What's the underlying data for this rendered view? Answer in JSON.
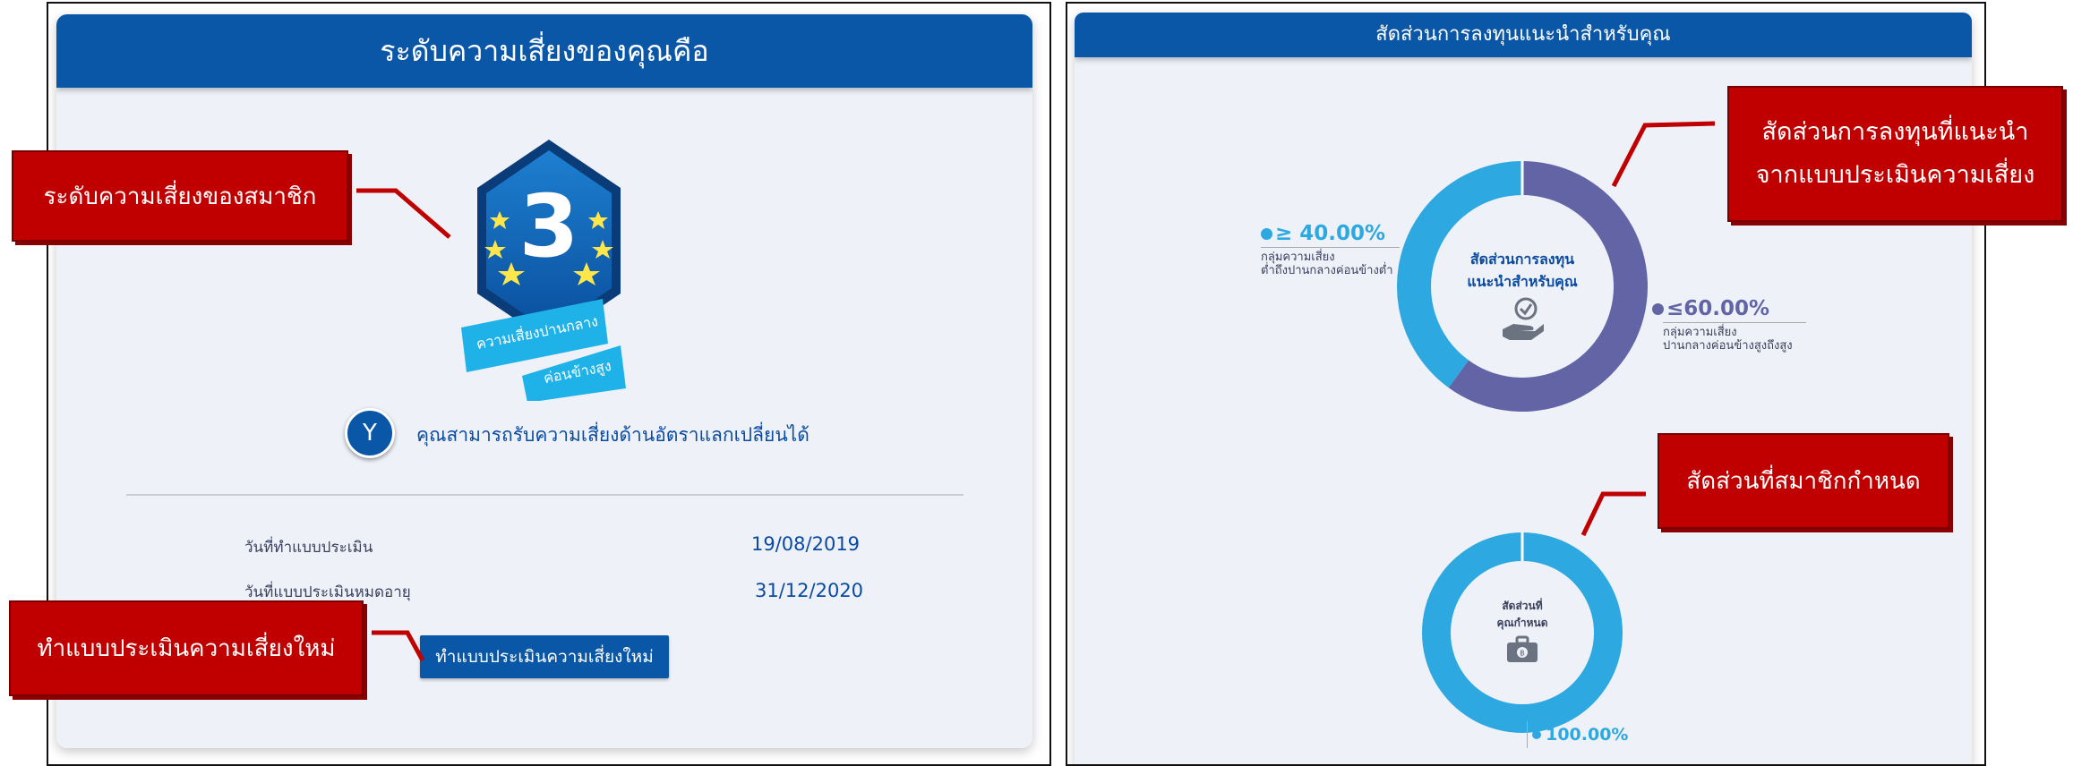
{
  "left_panel": {
    "title": "ระดับความเสี่ยงของคุณคือ",
    "badge": {
      "level": "3",
      "ribbon_line1": "ความเสี่ยงปานกลาง",
      "ribbon_line2": "ค่อนข้างสูง"
    },
    "fx_icon_letter": "Y",
    "fx_text": "คุณสามารถรับความเสี่ยงด้านอัตราแลกเปลี่ยนได้",
    "info_rows": [
      {
        "label": "วันที่ทำแบบประเมิน",
        "value": "19/08/2019"
      },
      {
        "label": "วันที่แบบประเมินหมดอายุ",
        "value": "31/12/2020"
      }
    ],
    "reassess_button": "ทำแบบประเมินความเสี่ยงใหม่"
  },
  "right_panel": {
    "title": "สัดส่วนการลงทุนแนะนำสำหรับคุณ",
    "recommended_donut": {
      "center_line1": "สัดส่วนการลงทุน",
      "center_line2": "แนะนำสำหรับคุณ",
      "segments": [
        {
          "value_label": "≥ 40.00%",
          "desc_line1": "กลุ่มความเสี่ยง",
          "desc_line2": "ต่ำถึงปานกลางค่อนข้างต่ำ",
          "percent": 40,
          "color": "#2ea8e0"
        },
        {
          "value_label": "≤60.00%",
          "desc_line1": "กลุ่มความเสี่ยง",
          "desc_line2": "ปานกลางค่อนข้างสูงถึงสูง",
          "percent": 60,
          "color": "#6364a6"
        }
      ]
    },
    "member_donut": {
      "center_line1": "สัดส่วนที่",
      "center_line2": "คุณกำหนด",
      "value_label": "100.00%",
      "percent": 100,
      "color": "#2ea8e0"
    }
  },
  "callouts": {
    "member_risk_level": "ระดับความเสี่ยงของสมาชิก",
    "new_assessment": "ทำแบบประเมินความเสี่ยงใหม่",
    "recommended_ratio_line1": "สัดส่วนการลงทุนที่แนะนำ",
    "recommended_ratio_line2": "จากแบบประเมินความเสี่ยง",
    "member_defined_ratio": "สัดส่วนที่สมาชิกกำหนด"
  },
  "colors": {
    "header_blue": "#0a57a8",
    "callout_red": "#c00000",
    "donut_light_blue": "#2ea8e0",
    "donut_purple": "#6364a6"
  }
}
